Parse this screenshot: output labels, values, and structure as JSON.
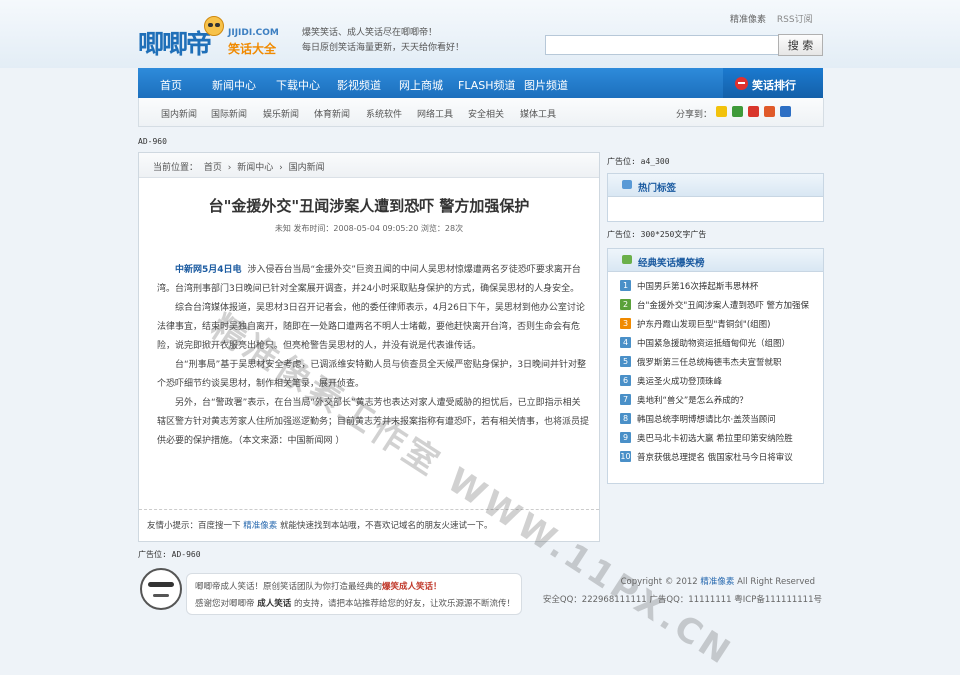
{
  "header": {
    "logo_main": "唧唧帝",
    "logo_domain": "JIJIDI.COM",
    "logo_sub": "笑话大全",
    "slogan_line1": "爆笑笑话、成人笑话尽在唧唧帝！",
    "slogan_line2": "每日原创笑话海量更新，天天给你看好！",
    "link_homepage": "精准像素",
    "link_rss": "RSS订阅",
    "search_value": "",
    "search_button": "搜 索"
  },
  "nav": {
    "items": [
      "首页",
      "新闻中心",
      "下载中心",
      "影视频道",
      "网上商城",
      "FLASH频道",
      "图片频道"
    ],
    "rank_label": "笑话排行"
  },
  "subnav": {
    "items": [
      "国内新闻",
      "国际新闻",
      "娱乐新闻",
      "体育新闻",
      "系统软件",
      "网络工具",
      "安全相关",
      "媒体工具"
    ],
    "share_label": "分享到："
  },
  "ads": {
    "top": "AD-960",
    "sidebar_top": "广告位: a4_300",
    "sidebar_mid": "广告位: 300*250文字广告",
    "bottom": "广告位: AD-960"
  },
  "breadcrumb": {
    "label": "当前位置：",
    "items": [
      "首页",
      "›",
      "新闻中心",
      "›",
      "国内新闻"
    ]
  },
  "article": {
    "title": "台\"金援外交\"丑闻涉案人遭到恐吓 警方加强保护",
    "meta": "未知  发布时间：2008-05-04 09:05:20  浏览：28次",
    "lead": "中新网5月4日电",
    "p1": "涉入侵吞台当局“金援外交”巨资丑闻的中间人吴思材惊爆遭两名歹徒恐吓要求离开台湾。台湾刑事部门3日晚间已针对全案展开调查，并24小时采取贴身保护的方式，确保吴思材的人身安全。",
    "p2": "综合台湾媒体报道，吴思材3日召开记者会，他的委任律师表示，4月26日下午，吴思材到他办公室讨论法律事宜，结束时吴独自离开，随即在一处路口遭两名不明人士堵截，要他赶快离开台湾，否则生命会有危险，说完即掀开衣服亮出枪只。但亮枪警告吴思材的人，并没有说是代表谁传话。",
    "p3": "台“刑事局”基于吴思材安全考虑，已调派维安特勤人员与侦查员全天候严密贴身保护，3日晚间并针对整个恐吓细节约谈吴思材，制作相关笔录，展开侦查。",
    "p4": "另外，台“警政署”表示，在台当局“外交部长”黄志芳也表达对家人遭受威胁的担忧后，已立即指示相关辖区警方针对黄志芳家人住所加强巡逻勤务；目前黄志芳并未报案指称有遭恐吓，若有相关情事，也将派员提供必要的保护措施。（本文来源：中国新闻网 ）",
    "tip_prefix": "友情小提示：百度搜一下",
    "tip_brand": "精准像素",
    "tip_suffix": "就能快速找到本站哦，不喜欢记域名的朋友火速试一下。"
  },
  "sidebar": {
    "hot_tags_title": "热门标签",
    "rank_title": "经典笑话爆笑榜",
    "rank_items": [
      {
        "num": "1",
        "text": "中国男乒第16次捧起斯韦思林杯"
      },
      {
        "num": "2",
        "text": "台\"金援外交\"丑闻涉案人遭到恐吓 警方加强保"
      },
      {
        "num": "3",
        "text": "护东丹霞山发现巨型\"青铜剑\"(组图)"
      },
      {
        "num": "4",
        "text": "中国紧急援助物资运抵缅甸仰光（组图）"
      },
      {
        "num": "5",
        "text": "俄罗斯第三任总统梅德韦杰夫宣誓就职"
      },
      {
        "num": "6",
        "text": "奥运圣火成功登顶珠峰"
      },
      {
        "num": "7",
        "text": "奥地利“兽父”是怎么养成的？"
      },
      {
        "num": "8",
        "text": "韩国总统李明博想请比尔·盖茨当顾问"
      },
      {
        "num": "9",
        "text": "奥巴马北卡初选大赢 希拉里印第安纳险胜"
      },
      {
        "num": "10",
        "text": "普京获俄总理提名 俄国家杜马今日将审议"
      }
    ]
  },
  "footer": {
    "line1_prefix": "唧唧帝成人笑话！原创笑话团队为你打造最经典的",
    "line1_hl": "爆笑成人笑话！",
    "line2_prefix": "感谢您对唧唧帝",
    "line2_bold": "成人笑话",
    "line2_suffix": "的支持，请把本站推荐给您的好友，让欢乐源源不断流传！",
    "copyright_prefix": "Copyright © 2012",
    "copyright_brand": "精准像素",
    "copyright_suffix": "All Right Reserved",
    "contact": "安全QQ：222968111111 广告QQ：11111111 粤ICP备111111111号"
  },
  "watermark": "精准像素工作室 WWW.11PX.CN",
  "colors": {
    "nav_bg": "#1c6fbd",
    "link_blue": "#2a6bb0",
    "rank_badge_blue": "#4a90c8",
    "rank_badge_green": "#5aa13a",
    "rank_badge_orange": "#f08a00"
  }
}
